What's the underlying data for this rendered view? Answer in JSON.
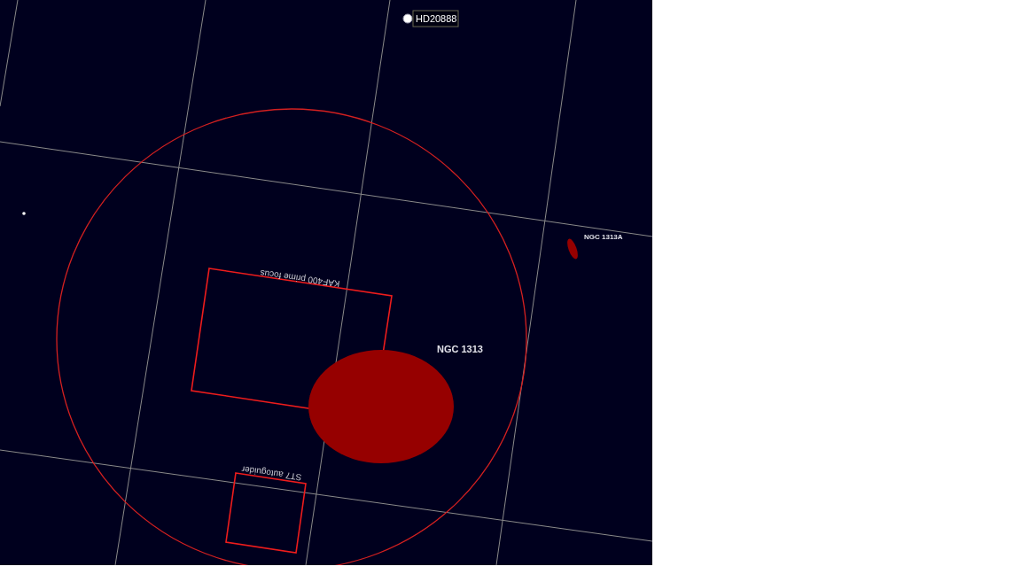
{
  "sky_chart": {
    "stars": [
      {
        "kind": "bright",
        "label": "HD20888"
      },
      {
        "kind": "faint"
      }
    ],
    "fov_indicators": [
      {
        "kind": "circle"
      },
      {
        "kind": "rect",
        "label": "KAF400 prime focus"
      },
      {
        "kind": "rect",
        "label": "ST7 autoguider"
      }
    ],
    "galaxies": [
      {
        "label": "NGC 1313"
      },
      {
        "label": "NGC 1313A"
      }
    ]
  }
}
